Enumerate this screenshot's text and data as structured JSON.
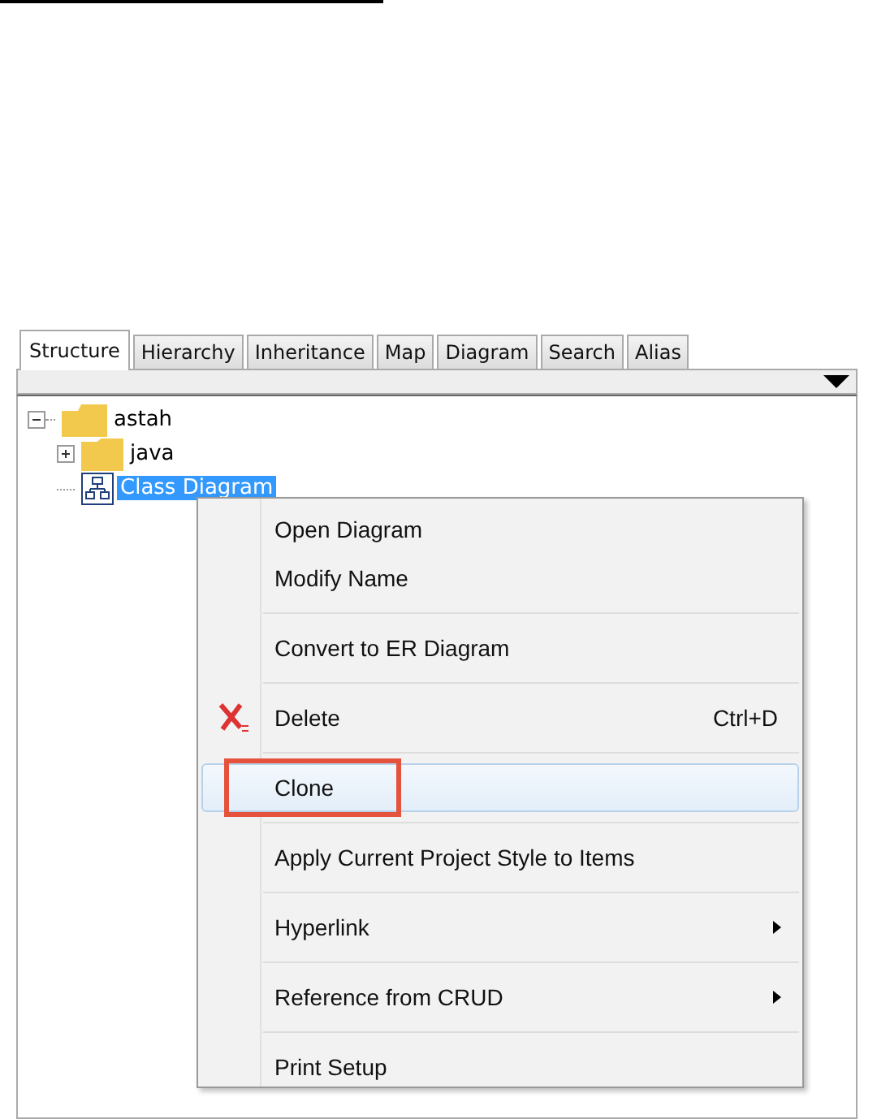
{
  "tabs": [
    {
      "label": "Structure",
      "selected": true
    },
    {
      "label": "Hierarchy",
      "selected": false
    },
    {
      "label": "Inheritance",
      "selected": false
    },
    {
      "label": "Map",
      "selected": false
    },
    {
      "label": "Diagram",
      "selected": false
    },
    {
      "label": "Search",
      "selected": false
    },
    {
      "label": "Alias",
      "selected": false
    }
  ],
  "tree": [
    {
      "label": "astah",
      "kind": "project",
      "expanded": true,
      "selected": false,
      "children": [
        {
          "label": "java",
          "kind": "folder",
          "expanded": false,
          "selected": false
        },
        {
          "label": "Class Diagram",
          "kind": "diagram",
          "selected": true
        }
      ]
    }
  ],
  "context_menu": {
    "groups": [
      [
        {
          "label": "Open Diagram",
          "kind": "item",
          "hovered": false,
          "outlined": false
        },
        {
          "label": "Modify Name",
          "kind": "item",
          "hovered": false,
          "outlined": false
        }
      ],
      [
        {
          "label": "Convert to ER Diagram",
          "kind": "item",
          "hovered": false,
          "outlined": false
        }
      ],
      [
        {
          "label": "Delete",
          "kind": "delete",
          "shortcut": "Ctrl+D",
          "hovered": false,
          "outlined": false
        }
      ],
      [
        {
          "label": "Clone",
          "kind": "item",
          "hovered": true,
          "outlined": true
        }
      ],
      [
        {
          "label": "Apply Current Project Style to Items",
          "kind": "item",
          "hovered": false,
          "outlined": false
        }
      ],
      [
        {
          "label": "Hyperlink",
          "kind": "submenu",
          "hovered": false,
          "outlined": false
        }
      ],
      [
        {
          "label": "Reference from CRUD",
          "kind": "submenu",
          "hovered": false,
          "outlined": false
        }
      ],
      [
        {
          "label": "Print Setup",
          "kind": "item",
          "hovered": false,
          "outlined": false
        }
      ]
    ]
  }
}
